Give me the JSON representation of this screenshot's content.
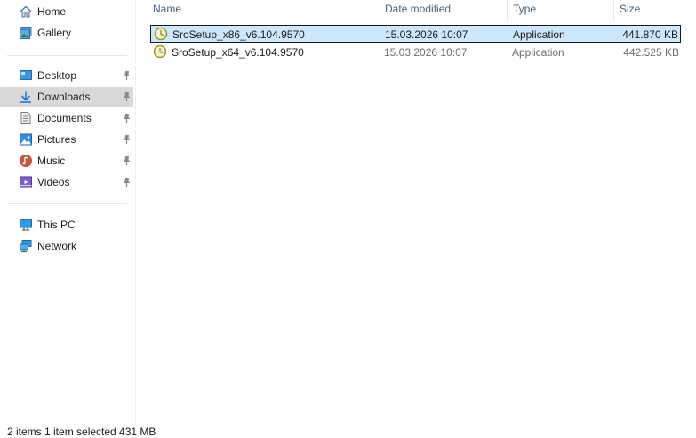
{
  "sidebar": {
    "quick": [
      {
        "label": "Home",
        "icon": "home-icon"
      },
      {
        "label": "Gallery",
        "icon": "gallery-icon"
      }
    ],
    "pinned": [
      {
        "label": "Desktop",
        "icon": "desktop-icon",
        "pinned": true
      },
      {
        "label": "Downloads",
        "icon": "downloads-icon",
        "pinned": true,
        "selected": true
      },
      {
        "label": "Documents",
        "icon": "documents-icon",
        "pinned": true
      },
      {
        "label": "Pictures",
        "icon": "pictures-icon",
        "pinned": true
      },
      {
        "label": "Music",
        "icon": "music-icon",
        "pinned": true
      },
      {
        "label": "Videos",
        "icon": "videos-icon",
        "pinned": true
      }
    ],
    "devices": [
      {
        "label": "This PC",
        "icon": "this-pc-icon"
      },
      {
        "label": "Network",
        "icon": "network-icon"
      }
    ]
  },
  "columns": {
    "name": "Name",
    "date": "Date modified",
    "type": "Type",
    "size": "Size"
  },
  "files": [
    {
      "name": "SroSetup_x86_v6.104.9570",
      "date": "15.03.2026 10:07",
      "type": "Application",
      "size": "441.870 KB",
      "selected": true
    },
    {
      "name": "SroSetup_x64_v6.104.9570",
      "date": "15.03.2026 10:07",
      "type": "Application",
      "size": "442.525 KB",
      "selected": false
    }
  ],
  "status": {
    "text": "2 items    1 item selected  431 MB"
  },
  "colors": {
    "selection": "#cce8ff",
    "nav_selected": "#d9d9d9",
    "header_text": "#4c607a",
    "secondary_text": "#6d6d6d"
  }
}
